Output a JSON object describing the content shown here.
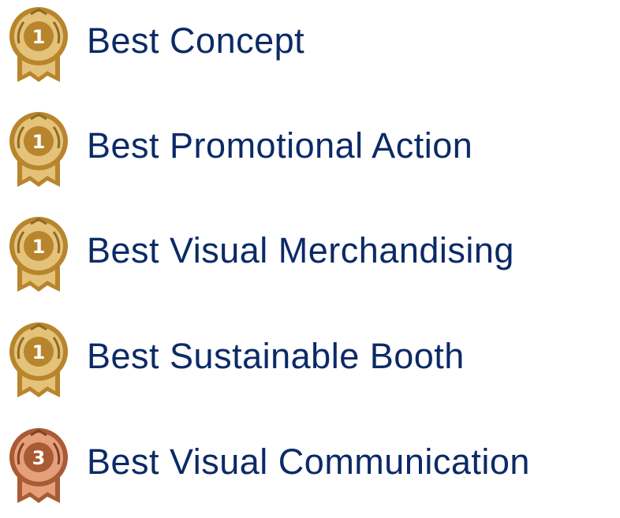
{
  "awards": [
    {
      "label": "Best Concept",
      "rank": "1",
      "medal": "gold-medal-icon"
    },
    {
      "label": "Best Promotional Action",
      "rank": "1",
      "medal": "gold-medal-icon"
    },
    {
      "label": "Best Visual Merchandising",
      "rank": "1",
      "medal": "gold-medal-icon"
    },
    {
      "label": "Best Sustainable Booth",
      "rank": "1",
      "medal": "gold-medal-icon"
    },
    {
      "label": "Best Visual Communication",
      "rank": "3",
      "medal": "bronze-medal-icon"
    }
  ],
  "colors": {
    "text": "#0b2a66",
    "gold_light": "#e4c27a",
    "gold_dark": "#b8852d",
    "bronze_light": "#e5a07b",
    "bronze_dark": "#a85b34"
  }
}
